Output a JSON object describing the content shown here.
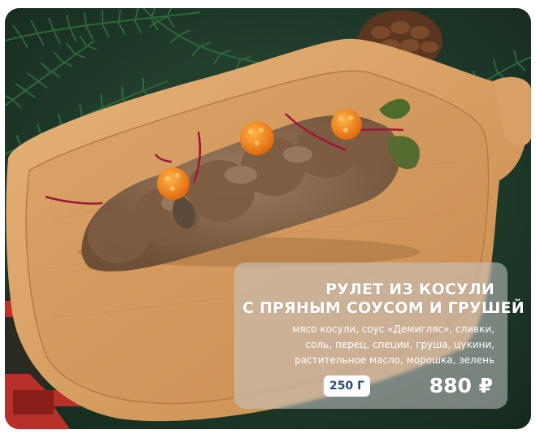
{
  "dish": {
    "title_line1": "РУЛЕТ ИЗ КОСУЛИ",
    "title_line2": "С ПРЯНЫМ СОУСОМ И ГРУШЕЙ",
    "ingredients_line1": "мясо косули, соус «Демигляс», сливки,",
    "ingredients_line2": "соль, перец, специи, груша, цукини,",
    "ingredients_line3": "растительное масло, морошка, зелень",
    "weight": "250 Г",
    "price": "880 ₽"
  },
  "photo": {
    "subject": "venison roll on wooden serving board with fir branches",
    "colors": {
      "background": "#1f3a2b",
      "board": "#d9a36a",
      "meat": "#8a6a4e",
      "cloudberry": "#f08a1e"
    }
  }
}
